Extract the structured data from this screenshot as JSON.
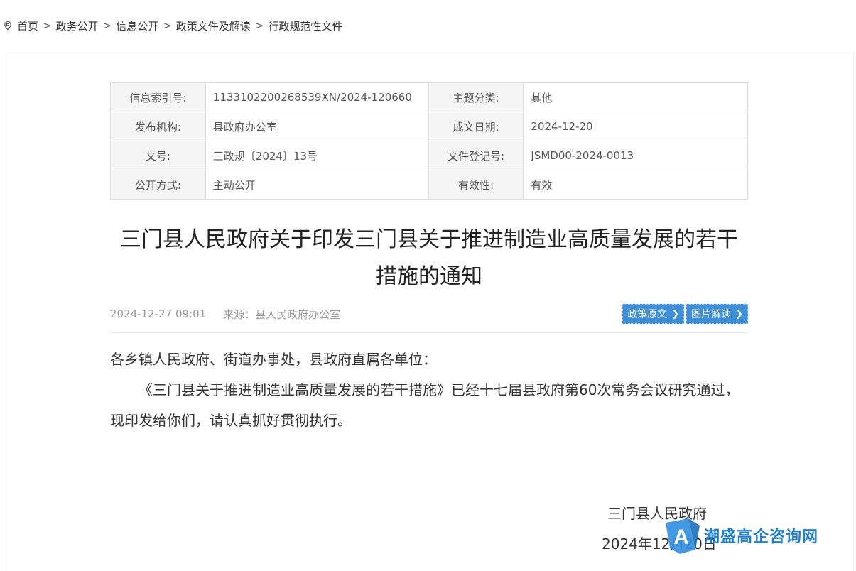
{
  "breadcrumb": {
    "items": [
      "首页",
      "政务公开",
      "信息公开",
      "政策文件及解读",
      "行政规范性文件"
    ],
    "separator": ">"
  },
  "meta": {
    "rows": [
      {
        "k1": "信息索引号:",
        "v1": "1133102200268539XN/2024-120660",
        "k2": "主题分类:",
        "v2": "其他"
      },
      {
        "k1": "发布机构:",
        "v1": "县政府办公室",
        "k2": "成文日期:",
        "v2": "2024-12-20"
      },
      {
        "k1": "文号:",
        "v1": "三政规〔2024〕13号",
        "k2": "文件登记号:",
        "v2": "JSMD00-2024-0013"
      },
      {
        "k1": "公开方式:",
        "v1": "主动公开",
        "k2": "有效性:",
        "v2": "有效"
      }
    ]
  },
  "article": {
    "title_line1": "三门县人民政府关于印发三门县关于推进制造业高质量发展的若干",
    "title_line2": "措施的通知",
    "datetime": "2024-12-27 09:01",
    "source": "来源：县人民政府办公室",
    "btn_original": "政策原文",
    "btn_graphic": "图片解读",
    "salutation": "各乡镇人民政府、街道办事处，县政府直属各单位：",
    "paragraph": "《三门县关于推进制造业高质量发展的若干措施》已经十七届县政府第60次常务会议研究通过，现印发给你们，请认真抓好贯彻执行。",
    "signer": "三门县人民政府",
    "sign_date": "2024年12月20日"
  },
  "watermark": {
    "letter": "A",
    "text": "潮盛高企咨询网"
  },
  "colors": {
    "accent": "#3d8fd8",
    "watermark": "#1e7ed4"
  }
}
